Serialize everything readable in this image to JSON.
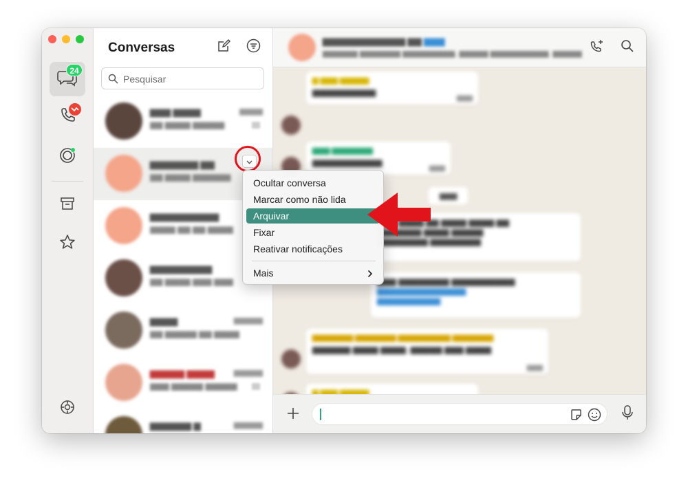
{
  "rail": {
    "unread_count": "24",
    "icons": [
      "chat-bubbles-icon",
      "phone-icon",
      "status-icon",
      "archive-icon",
      "star-icon",
      "settings-icon"
    ]
  },
  "chat_list": {
    "title": "Conversas",
    "search_placeholder": "Pesquisar"
  },
  "context_menu": {
    "items": [
      {
        "label": "Ocultar conversa"
      },
      {
        "label": "Marcar como não lida"
      },
      {
        "label": "Arquivar",
        "selected": true
      },
      {
        "label": "Fixar"
      },
      {
        "label": "Reativar notificações"
      }
    ],
    "more_label": "Mais"
  },
  "colors": {
    "accent": "#25d366",
    "menu_highlight": "#3f8f80",
    "annotation_red": "#e1141c",
    "chat_background": "#efeae2"
  }
}
